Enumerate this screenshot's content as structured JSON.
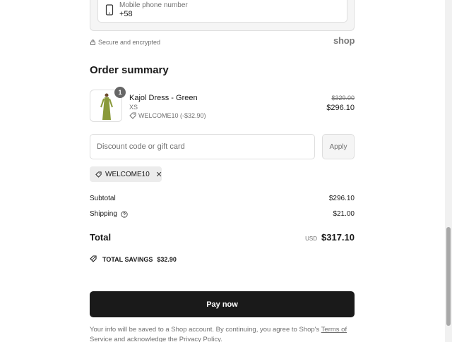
{
  "contact": {
    "phone_label": "Mobile phone number",
    "phone_value": "+58",
    "secure_text": "Secure and encrypted",
    "shop_logo": "shop"
  },
  "summary": {
    "title": "Order summary",
    "item": {
      "quantity": "1",
      "name": "Kajol Dress - Green",
      "variant": "XS",
      "discount_label": "WELCOME10 (-$32.90)",
      "original_price": "$329.00",
      "price": "$296.10",
      "image_color": "#8a9a3a"
    },
    "discount_placeholder": "Discount code or gift card",
    "apply_label": "Apply",
    "applied_code": "WELCOME10",
    "subtotal_label": "Subtotal",
    "subtotal_value": "$296.10",
    "shipping_label": "Shipping",
    "shipping_value": "$21.00",
    "total_label": "Total",
    "total_currency": "USD",
    "total_value": "$317.10",
    "savings_label": "TOTAL SAVINGS",
    "savings_value": "$32.90"
  },
  "pay_button_label": "Pay now",
  "footer": {
    "text_before": "Your info will be saved to a Shop account. By continuing, you agree to Shop's ",
    "terms_link": "Terms of Service",
    "text_middle": " and acknowledge the ",
    "privacy_link": "Privacy Policy",
    "text_after": "."
  },
  "colors": {
    "primary_button": "#1a1a1a",
    "muted_text": "#707070",
    "border": "#dedede"
  }
}
